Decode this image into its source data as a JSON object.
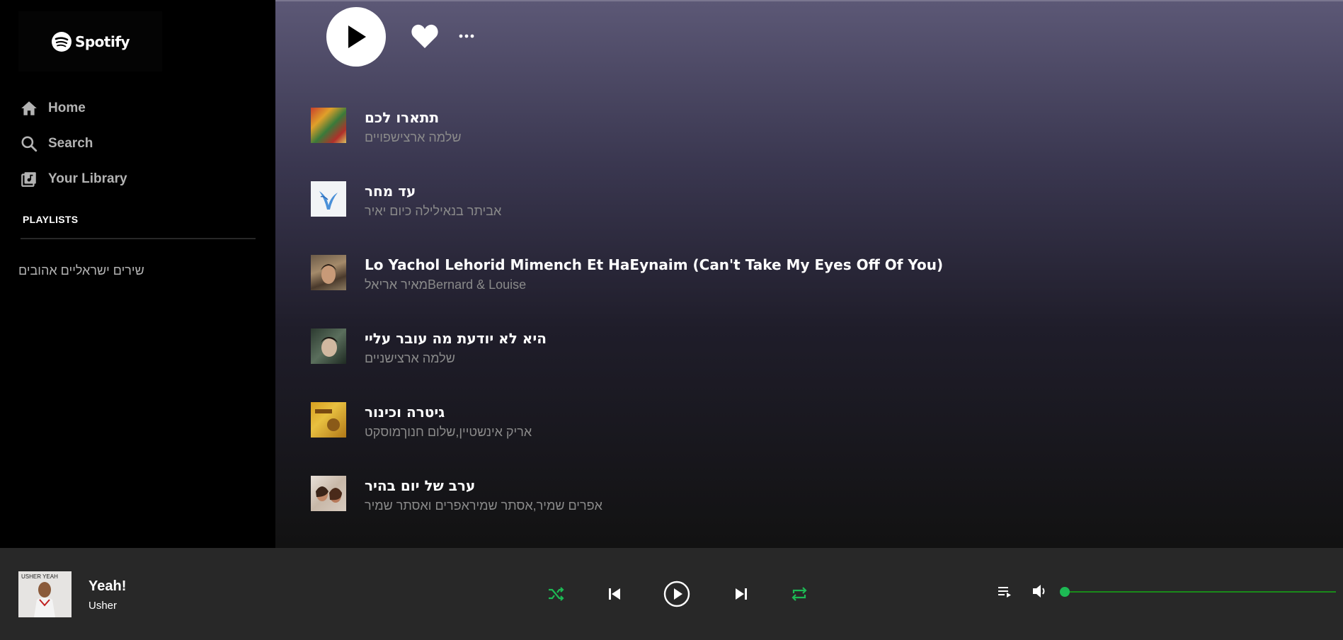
{
  "sidebar": {
    "logo_text": "Spotify",
    "nav": [
      {
        "label": "Home",
        "icon": "home-icon"
      },
      {
        "label": "Search",
        "icon": "search-icon"
      },
      {
        "label": "Your Library",
        "icon": "library-icon"
      }
    ],
    "playlists_header": "PLAYLISTS",
    "playlists": [
      "שירים ישראליים אהובים"
    ]
  },
  "main": {
    "tracks": [
      {
        "title": "תתארו לכם",
        "artist": "שלמה ארצישפויים"
      },
      {
        "title": "עד מחר",
        "artist": "אביתר בנאילילה כיום יאיר"
      },
      {
        "title": "Lo Yachol Lehorid Mimench Et HaEynaim (Can't Take My Eyes Off Of You)",
        "artist": "מאיר אריאלBernard & Louise"
      },
      {
        "title": "היא לא יודעת מה עובר עליי",
        "artist": "שלמה ארצישניים"
      },
      {
        "title": "גיטרה וכינור",
        "artist": "אריק אינשטיין,שלום חנוךמוסקט"
      },
      {
        "title": "ערב של יום בהיר",
        "artist": "אפרים שמיר,אסתר שמיראפרים ואסתר שמיר"
      }
    ]
  },
  "player": {
    "title": "Yeah!",
    "artist": "Usher",
    "cover_text": "USHER YEAH",
    "accent_color": "#1db954",
    "shuffle_active": true,
    "repeat_active": true,
    "volume": 0.0
  }
}
